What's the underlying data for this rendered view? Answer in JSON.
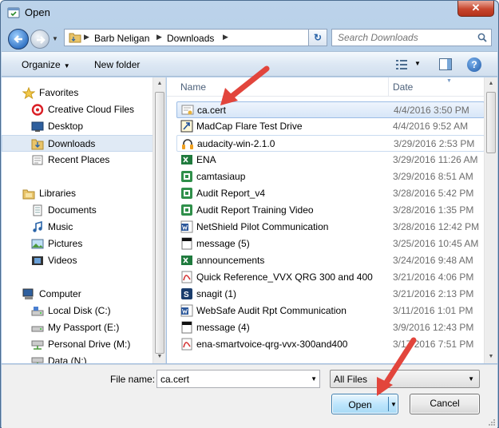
{
  "window": {
    "title": "Open",
    "close_symbol": "✕"
  },
  "address": {
    "crumbs": [
      "Barb Neligan",
      "Downloads"
    ],
    "search_placeholder": "Search Downloads"
  },
  "toolbar": {
    "organize_label": "Organize",
    "new_folder_label": "New folder"
  },
  "nav": {
    "favorites": {
      "label": "Favorites",
      "items": [
        "Creative Cloud Files",
        "Desktop",
        "Downloads",
        "Recent Places"
      ]
    },
    "libraries": {
      "label": "Libraries",
      "items": [
        "Documents",
        "Music",
        "Pictures",
        "Videos"
      ]
    },
    "computer": {
      "label": "Computer",
      "items": [
        "Local Disk (C:)",
        "My Passport (E:)",
        "Personal Drive (M:)",
        "Data (N:)"
      ]
    },
    "selected": "Downloads"
  },
  "columns": {
    "name": "Name",
    "date": "Date"
  },
  "files": [
    {
      "name": "ca.cert",
      "date": "4/4/2016 3:50 PM",
      "icon": "certificate-icon",
      "state": "selected"
    },
    {
      "name": "MadCap Flare Test Drive",
      "date": "4/4/2016 9:52 AM",
      "icon": "shortcut-icon",
      "state": ""
    },
    {
      "name": "audacity-win-2.1.0",
      "date": "3/29/2016 2:53 PM",
      "icon": "headphones-icon",
      "state": "hover"
    },
    {
      "name": "ENA",
      "date": "3/29/2016 11:26 AM",
      "icon": "excel-icon",
      "state": ""
    },
    {
      "name": "camtasiaup",
      "date": "3/29/2016 8:51 AM",
      "icon": "camtasia-icon",
      "state": ""
    },
    {
      "name": "Audit Report_v4",
      "date": "3/28/2016 5:42 PM",
      "icon": "camtasia-icon",
      "state": ""
    },
    {
      "name": "Audit Report Training Video",
      "date": "3/28/2016 1:35 PM",
      "icon": "camtasia-icon",
      "state": ""
    },
    {
      "name": "NetShield Pilot Communication",
      "date": "3/28/2016 12:42 PM",
      "icon": "word-icon",
      "state": ""
    },
    {
      "name": "message (5)",
      "date": "3/25/2016 10:45 AM",
      "icon": "mail-file-icon",
      "state": ""
    },
    {
      "name": "announcements",
      "date": "3/24/2016 9:48 AM",
      "icon": "excel-icon",
      "state": ""
    },
    {
      "name": "Quick Reference_VVX QRG 300 and 400",
      "date": "3/21/2016 4:06 PM",
      "icon": "pdf-icon",
      "state": ""
    },
    {
      "name": "snagit (1)",
      "date": "3/21/2016 2:13 PM",
      "icon": "snagit-icon",
      "state": ""
    },
    {
      "name": "WebSafe Audit Rpt Communication",
      "date": "3/11/2016 1:01 PM",
      "icon": "word-icon",
      "state": ""
    },
    {
      "name": "message (4)",
      "date": "3/9/2016 12:43 PM",
      "icon": "mail-file-icon",
      "state": ""
    },
    {
      "name": "ena-smartvoice-qrg-vvx-300and400",
      "date": "3/17/2016 7:51 PM",
      "icon": "pdf-icon",
      "state": ""
    }
  ],
  "bottom": {
    "file_name_label": "File name:",
    "file_name_value": "ca.cert",
    "file_type": "All Files",
    "open_label": "Open",
    "cancel_label": "Cancel"
  },
  "colors": {
    "annotation_arrow": "#e2453c",
    "selection": "#d7e6f8"
  }
}
